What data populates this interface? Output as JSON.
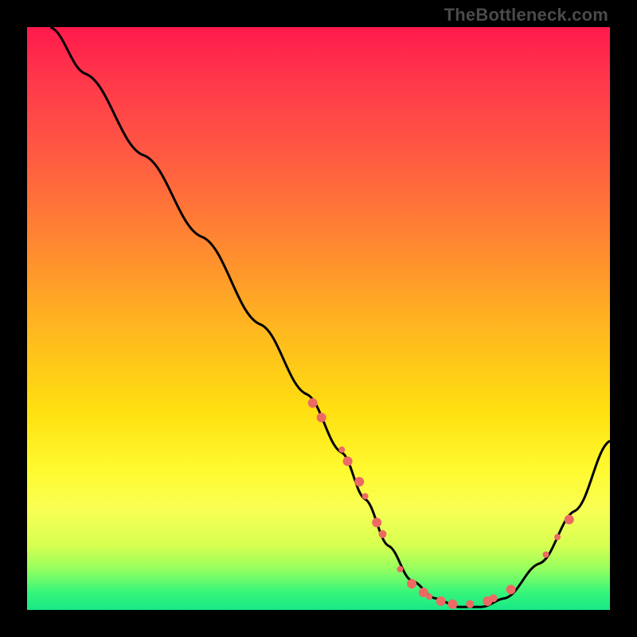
{
  "watermark": "TheBottleneck.com",
  "chart_data": {
    "type": "line",
    "title": "",
    "xlabel": "",
    "ylabel": "",
    "xlim": [
      0,
      100
    ],
    "ylim": [
      0,
      100
    ],
    "series": [
      {
        "name": "curve",
        "x": [
          4,
          10,
          20,
          30,
          40,
          48,
          54,
          58,
          62,
          66,
          70,
          74,
          78,
          82,
          88,
          94,
          100
        ],
        "y": [
          100,
          92,
          78,
          64,
          49,
          37,
          27,
          19,
          11,
          5,
          2,
          0.5,
          0.5,
          2,
          8,
          17,
          29
        ]
      }
    ],
    "markers": [
      {
        "x": 49,
        "y": 35.5,
        "r": 6
      },
      {
        "x": 50.5,
        "y": 33,
        "r": 6
      },
      {
        "x": 54,
        "y": 27.5,
        "r": 4
      },
      {
        "x": 55,
        "y": 25.5,
        "r": 6
      },
      {
        "x": 57,
        "y": 22,
        "r": 6
      },
      {
        "x": 58,
        "y": 19.5,
        "r": 4
      },
      {
        "x": 60,
        "y": 15,
        "r": 6
      },
      {
        "x": 61,
        "y": 13,
        "r": 5
      },
      {
        "x": 64,
        "y": 7,
        "r": 4
      },
      {
        "x": 66,
        "y": 4.5,
        "r": 6
      },
      {
        "x": 68,
        "y": 3,
        "r": 6
      },
      {
        "x": 69,
        "y": 2.3,
        "r": 4
      },
      {
        "x": 71,
        "y": 1.5,
        "r": 6
      },
      {
        "x": 73,
        "y": 1,
        "r": 6
      },
      {
        "x": 76,
        "y": 1,
        "r": 5
      },
      {
        "x": 79,
        "y": 1.5,
        "r": 6
      },
      {
        "x": 80,
        "y": 2,
        "r": 5
      },
      {
        "x": 83,
        "y": 3.5,
        "r": 6
      },
      {
        "x": 89,
        "y": 9.5,
        "r": 4
      },
      {
        "x": 91,
        "y": 12.5,
        "r": 4
      },
      {
        "x": 93,
        "y": 15.5,
        "r": 6
      }
    ],
    "marker_color": "#ec6a63",
    "curve_color": "#000000",
    "curve_width": 3
  }
}
